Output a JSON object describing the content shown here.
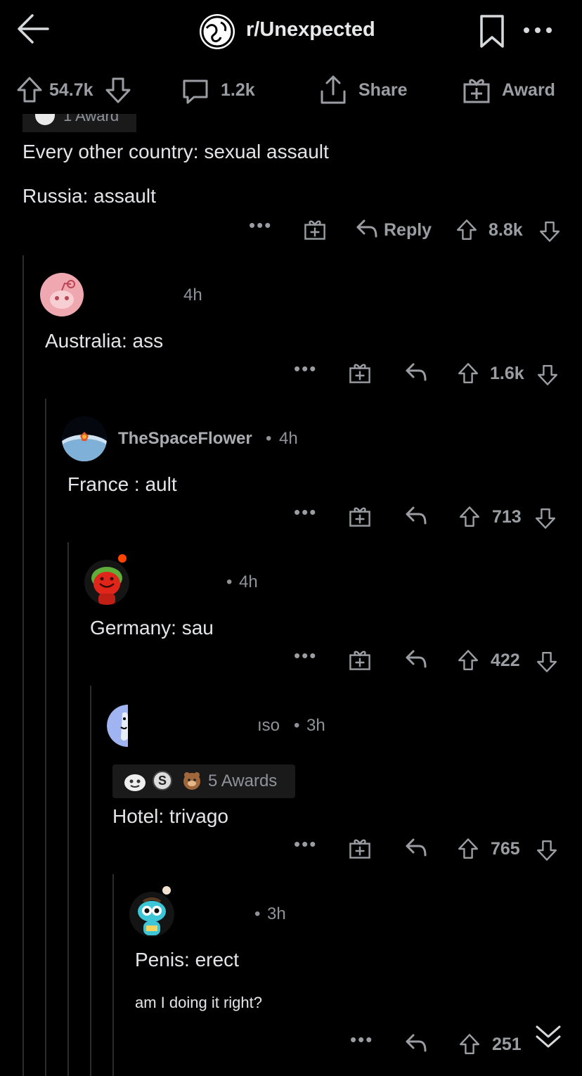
{
  "header": {
    "subreddit": "r/Unexpected"
  },
  "post_bar": {
    "score": "54.7k",
    "comments": "1.2k",
    "share_label": "Share",
    "award_label": "Award"
  },
  "top_comment": {
    "award_label": "1 Award",
    "line1": "Every other country: sexual assault",
    "line2": "Russia: assault",
    "reply_label": "Reply",
    "score": "8.8k"
  },
  "comments": [
    {
      "author": "",
      "time": "4h",
      "text": "Australia: ass",
      "score": "1.6k"
    },
    {
      "author": "TheSpaceFlower",
      "time": "4h",
      "text": "France : ault",
      "score": "713"
    },
    {
      "author": "",
      "time": "4h",
      "text": "Germany: sau",
      "score": "422"
    },
    {
      "author": "ıso",
      "time": "3h",
      "awards": "5 Awards",
      "text": "Hotel: trivago",
      "score": "765"
    },
    {
      "author": "",
      "time": "3h",
      "text": "Penis: erect",
      "text2": "am I doing it right?",
      "score": "251"
    }
  ],
  "icons": {
    "back": "back-arrow-icon",
    "bookmark": "bookmark-icon",
    "more": "more-dots-icon",
    "upvote": "upvote-arrow-icon",
    "downvote": "downvote-arrow-icon",
    "comment": "comment-bubble-icon",
    "share": "share-icon",
    "award": "gift-award-icon",
    "reply": "reply-arrow-icon",
    "collapse": "collapse-chevrons-icon"
  }
}
